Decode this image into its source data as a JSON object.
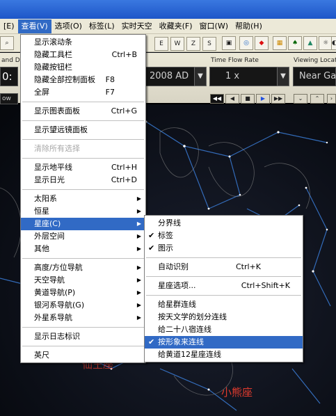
{
  "menubar": {
    "items": [
      {
        "label": "[E)"
      },
      {
        "label": "查看(V)"
      },
      {
        "label": "选项(O)"
      },
      {
        "label": "标签(L)"
      },
      {
        "label": "实时天空"
      },
      {
        "label": "收藏夹(F)"
      },
      {
        "label": "窗口(W)"
      },
      {
        "label": "帮助(H)"
      }
    ]
  },
  "panel": {
    "date_label": "and Da",
    "date_value": "2008 AD",
    "time_flow_label": "Time Flow Rate",
    "time_flow_value": "1 x",
    "viewing_label": "Viewing Locatio",
    "viewing_value": "Near Ganz",
    "clock_partial": "0:",
    "left_field_partial": "ow"
  },
  "view_menu": {
    "groups": [
      [
        {
          "label": "显示滚动条",
          "shortcut": ""
        },
        {
          "label": "隐藏工具栏",
          "shortcut": "Ctrl+B"
        },
        {
          "label": "隐藏按钮栏",
          "shortcut": ""
        },
        {
          "label": "隐藏全部控制面板",
          "shortcut": "F8"
        },
        {
          "label": "全屏",
          "shortcut": "F7"
        }
      ],
      [
        {
          "label": "显示图表面板",
          "shortcut": "Ctrl+G"
        }
      ],
      [
        {
          "label": "显示望远镜面板",
          "shortcut": ""
        }
      ],
      [
        {
          "label": "清除所有选择",
          "shortcut": "",
          "disabled": true
        }
      ],
      [
        {
          "label": "显示地平线",
          "shortcut": "Ctrl+H"
        },
        {
          "label": "显示日光",
          "shortcut": "Ctrl+D"
        }
      ],
      [
        {
          "label": "太阳系",
          "submenu": true
        },
        {
          "label": "恒星",
          "submenu": true
        },
        {
          "label": "星座(C)",
          "submenu": true,
          "highlighted": true
        },
        {
          "label": "外层空间",
          "submenu": true
        },
        {
          "label": "其他",
          "submenu": true
        }
      ],
      [
        {
          "label": "高度/方位导航",
          "submenu": true
        },
        {
          "label": "天空导航",
          "submenu": true
        },
        {
          "label": "黄道导航(P)",
          "submenu": true
        },
        {
          "label": "银河系导航(G)",
          "submenu": true
        },
        {
          "label": "外星系导航",
          "submenu": true
        }
      ],
      [
        {
          "label": "显示日志标识"
        }
      ],
      [
        {
          "label": "英尺"
        }
      ]
    ]
  },
  "constellation_menu": {
    "groups": [
      [
        {
          "label": "分界线",
          "checked": false
        },
        {
          "label": "标签",
          "checked": true
        },
        {
          "label": "图示",
          "checked": true
        }
      ],
      [
        {
          "label": "自动识别",
          "shortcut": "Ctrl+K"
        }
      ],
      [
        {
          "label": "星座选项...",
          "shortcut": "Ctrl+Shift+K"
        }
      ],
      [
        {
          "label": "给星群连线",
          "checked": false
        },
        {
          "label": "按天文学的划分连线",
          "checked": false
        },
        {
          "label": "给二十八宿连线",
          "checked": false
        },
        {
          "label": "按形象来连线",
          "checked": true,
          "highlighted": true
        },
        {
          "label": "给黄道12星座连线",
          "checked": false
        }
      ]
    ]
  },
  "sky_labels": {
    "small_bear": "小熊座",
    "partial_label": "仙王座"
  },
  "colors": {
    "menu_highlight": "#316ac5",
    "menubar_bg": "#ece9d8",
    "constellation_line": "#3a7bd5",
    "sky_label": "#e23b2e"
  },
  "toolbar": {
    "compass_labels": [
      "E",
      "W",
      "Z",
      "S"
    ]
  }
}
